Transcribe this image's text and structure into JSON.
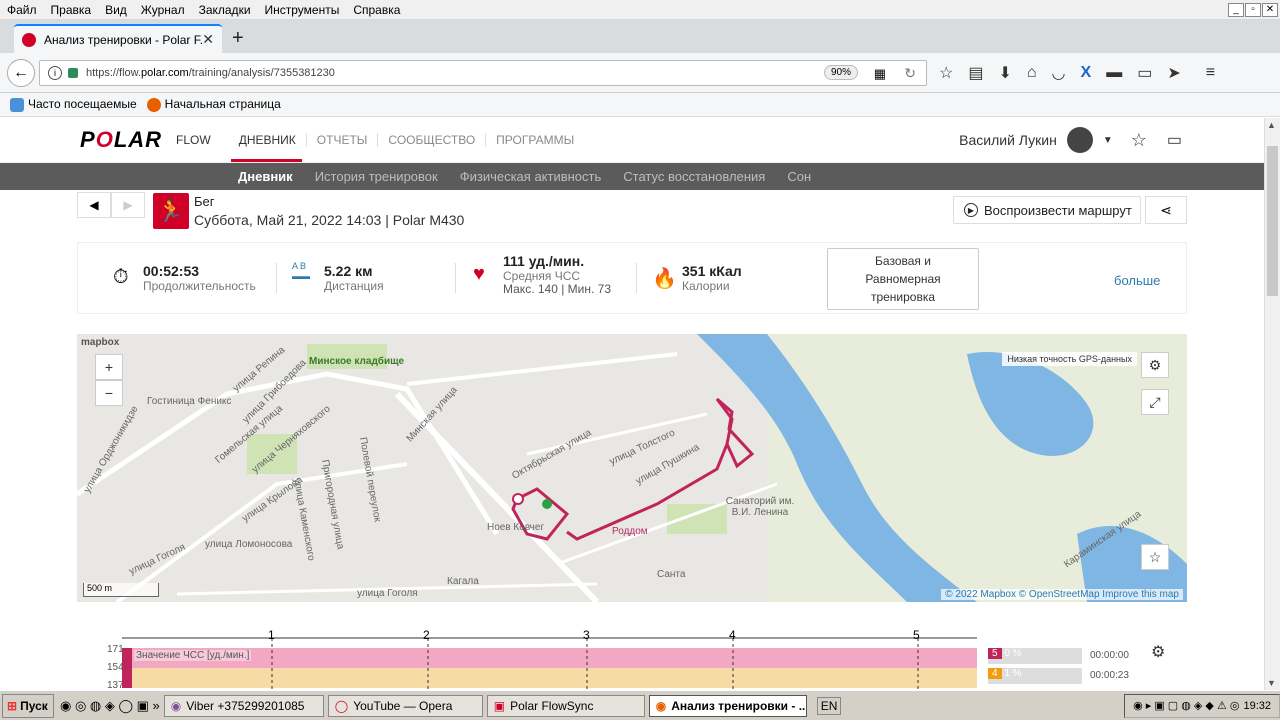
{
  "browser": {
    "menu": [
      "Файл",
      "Правка",
      "Вид",
      "Журнал",
      "Закладки",
      "Инструменты",
      "Справка"
    ],
    "tab_title": "Анализ тренировки - Polar F...",
    "url_prefix": "https://flow.",
    "url_domain": "polar.com",
    "url_path": "/training/analysis/7355381230",
    "zoom": "90%",
    "bookmarks": [
      "Часто посещаемые",
      "Начальная страница"
    ]
  },
  "site": {
    "logo_text": "P",
    "logo_o": "O",
    "logo_rest": "LAR",
    "flow_label": "FLOW",
    "nav": [
      "ДНЕВНИК",
      "ОТЧЕТЫ",
      "СООБЩЕСТВО",
      "ПРОГРАММЫ"
    ],
    "user_name": "Василий Лукин",
    "subnav": [
      "Дневник",
      "История тренировок",
      "Физическая активность",
      "Статус восстановления",
      "Сон"
    ]
  },
  "training": {
    "sport": "Бег",
    "date": "Суббота, Май 21, 2022 14:03 | Polar M430",
    "replay_label": "Воспроизвести маршрут",
    "duration_value": "00:52:53",
    "duration_label": "Продолжительность",
    "distance_value": "5.22 км",
    "distance_label": "Дистанция",
    "distance_ab": "A B",
    "hr_value": "111 уд./мин.",
    "hr_label": "Средняя ЧСС",
    "hr_minmax": "Макс. 140 | Мин. 73",
    "calories_value": "351 кКал",
    "calories_label": "Калории",
    "training_type": "Базовая и Равномерная тренировка",
    "more_label": "больше"
  },
  "map": {
    "gps_note": "Низкая точность GPS-данных",
    "scale_label": "500 m",
    "attribution": "© 2022 Mapbox © OpenStreetMap Improve this map",
    "logo": "mapbox",
    "labels": [
      "Минское кладбище",
      "Гостиница Феникс",
      "улица Репина",
      "улица Грибоедова",
      "Гомельская улица",
      "улица Черняховского",
      "Минская улица",
      "улица Крылова",
      "Полевой переулок",
      "Пригородная улица",
      "улица Каменского",
      "улица Ломоносова",
      "улица Гоголя",
      "улица Орджоникидзе",
      "Октябрьская улица",
      "улица Толстого",
      "улица Пушкина",
      "Ноев Ковчег",
      "Роддом",
      "Санаторий им. В.И. Ленина",
      "Кагала",
      "Санта",
      "Караминская улица",
      "улица Гоголя"
    ]
  },
  "chart": {
    "series_label": "Значение ЧСС [уд./мин.]",
    "km_marks": [
      "1",
      "2",
      "3",
      "4",
      "5"
    ],
    "y_ticks": [
      "171",
      "154",
      "137"
    ],
    "zones": [
      {
        "zone": "5",
        "pct": "0 %",
        "time": "00:00:00"
      },
      {
        "zone": "4",
        "pct": "1 %",
        "time": "00:00:23"
      }
    ]
  },
  "taskbar": {
    "start": "Пуск",
    "items": [
      "Viber +375299201085",
      "YouTube — Opera",
      "Polar FlowSync",
      "Анализ тренировки - ..."
    ],
    "lang": "EN",
    "clock": "19:32"
  }
}
